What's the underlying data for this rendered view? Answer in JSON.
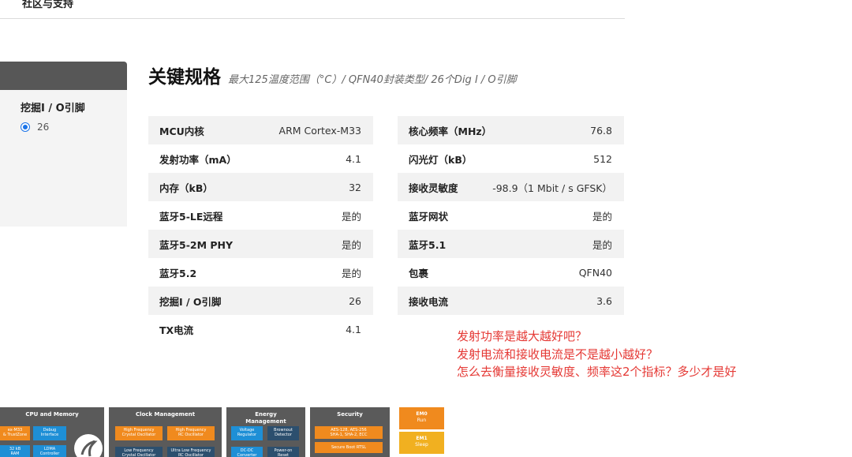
{
  "nav": {
    "community_link": "社区与支持"
  },
  "sidebar": {
    "filter_title": "挖掘I / O引脚",
    "option_value": "26"
  },
  "heading": {
    "title": "关键规格",
    "subtitle": "最大125温度范围（°C）/ QFN40封装类型/ 26个Dig I / O引脚"
  },
  "specs_left": [
    {
      "label": "MCU内核",
      "value": "ARM Cortex-M33"
    },
    {
      "label": "发射功率（mA）",
      "value": "4.1"
    },
    {
      "label": "内存（kB）",
      "value": "32"
    },
    {
      "label": "蓝牙5-LE远程",
      "value": "是的"
    },
    {
      "label": "蓝牙5-2M PHY",
      "value": "是的"
    },
    {
      "label": "蓝牙5.2",
      "value": "是的"
    },
    {
      "label": "挖掘I / O引脚",
      "value": "26"
    },
    {
      "label": "TX电流",
      "value": "4.1"
    }
  ],
  "specs_right": [
    {
      "label": "核心频率（MHz）",
      "value": "76.8"
    },
    {
      "label": "闪光灯（kB）",
      "value": "512"
    },
    {
      "label": "接收灵敏度",
      "value": "-98.9（1 Mbit / s GFSK）"
    },
    {
      "label": "蓝牙网状",
      "value": "是的"
    },
    {
      "label": "蓝牙5.1",
      "value": "是的"
    },
    {
      "label": "包裹",
      "value": "QFN40"
    },
    {
      "label": "接收电流",
      "value": "3.6"
    }
  ],
  "annotation": {
    "lines": [
      "发射功率是越大越好吧？",
      "发射电流和接收电流是不是越小越好？",
      "怎么去衡量接收灵敏度、频率这2个指标？多少才是好"
    ],
    "color": "#e53935"
  },
  "diagram": {
    "cpu": {
      "title": "CPU and Memory",
      "chips": [
        "ex-M33\n& TrustZone",
        "Debug\nInterface",
        "32 kB\nRAM",
        "LDMA\nController"
      ]
    },
    "clock": {
      "title": "Clock Management",
      "chips": [
        "High Frequency\nCrystal Oscillator",
        "High Frequency\nRC Oscillator",
        "Low Frequency\nCrystal Oscillator",
        "Ultra Low Frequency\nRC Oscillator"
      ]
    },
    "energy": {
      "title": "Energy\nManagement",
      "chips": [
        "Voltage\nRegulator",
        "Brownout\nDetector",
        "DC-DC\nConverter",
        "Power-on\nReset"
      ]
    },
    "security": {
      "title": "Security",
      "chips": [
        "AES-128, AES-256\nSHA-1, SHA-2, ECC",
        "Secure Boot RTSL"
      ]
    },
    "energy_modes": [
      {
        "name": "EM0",
        "desc": "Run"
      },
      {
        "name": "EM1",
        "desc": "Sleep"
      }
    ],
    "colors": {
      "orange": "#f08a1e",
      "blue": "#1e8fd6",
      "dark": "#2c4f6e",
      "block": "#5a5a5a",
      "yellow": "#f1b020"
    }
  }
}
